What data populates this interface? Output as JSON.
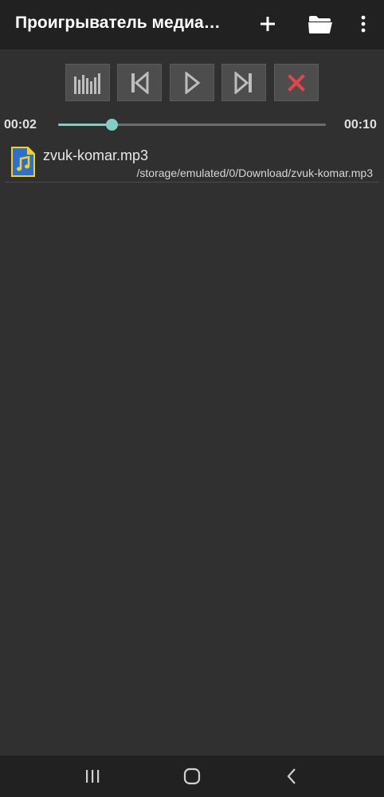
{
  "app_bar": {
    "title": "Проигрыватель медиа…",
    "icons": [
      "plus-icon",
      "folder-icon",
      "more-vert-icon"
    ]
  },
  "controls": {
    "icons": [
      "equalizer-icon",
      "skip-previous-icon",
      "play-icon",
      "skip-next-icon",
      "close-icon"
    ],
    "close_color": "#e8434b"
  },
  "seek": {
    "current_time": "00:02",
    "total_time": "00:10",
    "progress": 0.2,
    "accent_color": "#7fcfc5"
  },
  "playlist": {
    "items": [
      {
        "name": "zvuk-komar.mp3",
        "path": "/storage/emulated/0/Download/zvuk-komar.mp3",
        "icon": "audio-file-icon"
      }
    ]
  },
  "nav_bar": {
    "icons": [
      "recent-apps-icon",
      "home-icon",
      "back-icon"
    ]
  }
}
